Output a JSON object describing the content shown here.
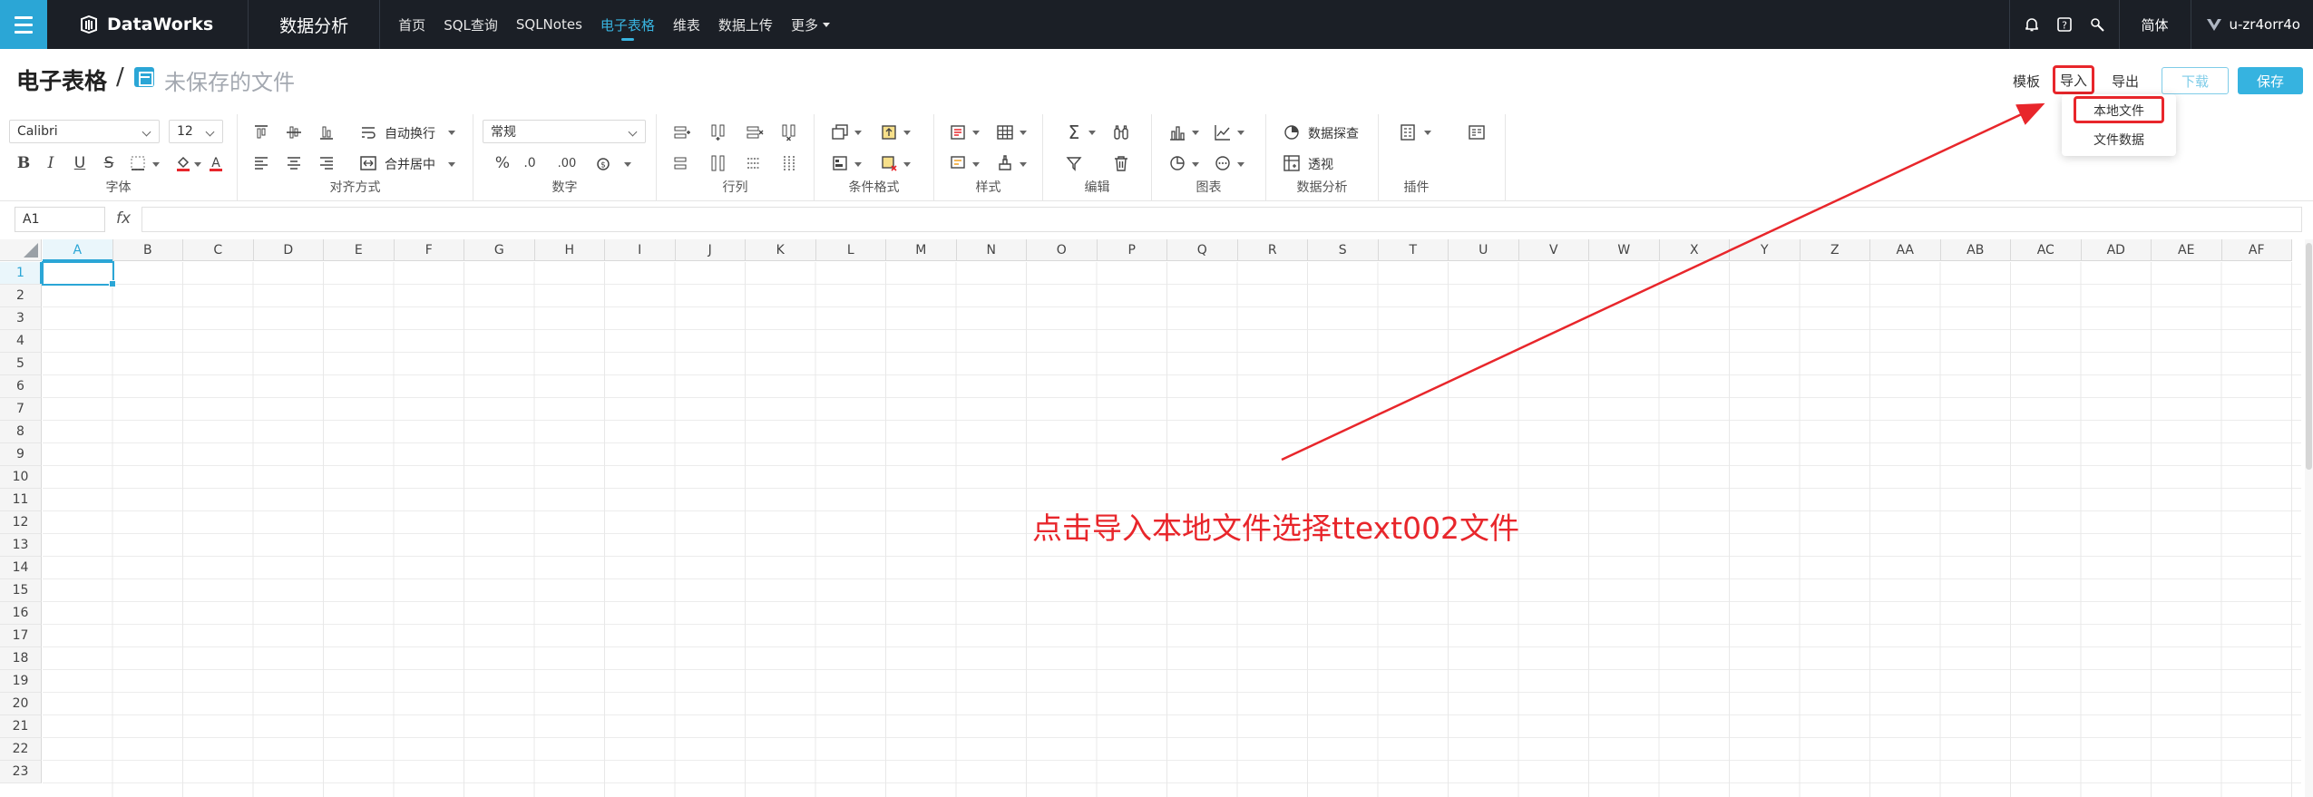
{
  "topbar": {
    "brand": "DataWorks",
    "product": "数据分析",
    "nav": [
      "首页",
      "SQL查询",
      "SQLNotes",
      "电子表格",
      "维表",
      "数据上传",
      "更多"
    ],
    "active_nav": "电子表格",
    "language": "简体",
    "username": "u-zr4orr4o"
  },
  "header": {
    "title": "电子表格",
    "separator": "/",
    "file_name": "未保存的文件",
    "buttons": {
      "template": "模板",
      "import": "导入",
      "export": "导出",
      "download": "下载",
      "save": "保存"
    },
    "import_menu": [
      "本地文件",
      "文件数据"
    ]
  },
  "toolbar": {
    "font_family": "Calibri",
    "font_size": "12",
    "wrap_text": "自动换行",
    "merge_center": "合并居中",
    "number_format": "常规",
    "data_explore": "数据探查",
    "pivot": "透视",
    "groups": [
      "字体",
      "对齐方式",
      "数字",
      "行列",
      "条件格式",
      "样式",
      "编辑",
      "图表",
      "数据分析",
      "插件"
    ]
  },
  "formula_bar": {
    "cell_ref": "A1",
    "fx": "fx"
  },
  "grid": {
    "columns": [
      "A",
      "B",
      "C",
      "D",
      "E",
      "F",
      "G",
      "H",
      "I",
      "J",
      "K",
      "L",
      "M",
      "N",
      "O",
      "P",
      "Q",
      "R",
      "S",
      "T",
      "U",
      "V",
      "W",
      "X",
      "Y",
      "Z",
      "AA",
      "AB",
      "AC",
      "AD",
      "AE",
      "AF"
    ],
    "rows": [
      "1",
      "2",
      "3",
      "4",
      "5",
      "6",
      "7",
      "8",
      "9",
      "10",
      "11",
      "12",
      "13",
      "14",
      "15",
      "16",
      "17",
      "18",
      "19",
      "20",
      "21",
      "22",
      "23"
    ]
  },
  "annotation": "点击导入本地文件选择ttext002文件",
  "colors": {
    "accent": "#2ba6d6",
    "topbar": "#1b1f26",
    "annotation": "#e8262b"
  }
}
